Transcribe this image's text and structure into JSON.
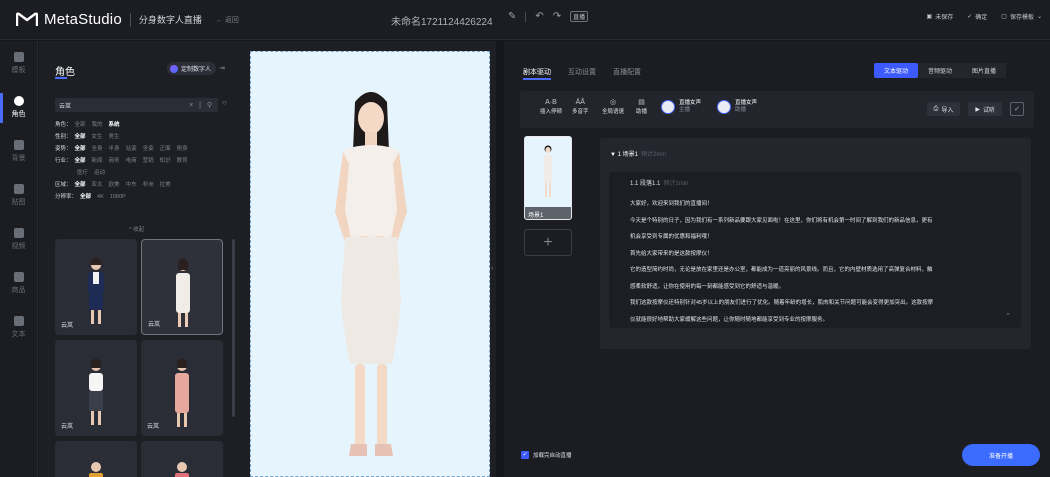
{
  "topbar": {
    "brand": "MetaStudio",
    "product": "分身数字人直播",
    "back_label": "← 返回",
    "project_name": "未命名1721124426224",
    "key_badge": "直播",
    "unsaved": "未保存",
    "confirm": "确定",
    "save_template": "保存模板"
  },
  "rail": {
    "items": [
      {
        "label": "模板",
        "icon": "template-icon"
      },
      {
        "label": "角色",
        "icon": "person-icon"
      },
      {
        "label": "背景",
        "icon": "background-icon"
      },
      {
        "label": "贴图",
        "icon": "sticker-icon"
      },
      {
        "label": "视频",
        "icon": "video-icon"
      },
      {
        "label": "商品",
        "icon": "product-icon"
      },
      {
        "label": "文本",
        "icon": "text-icon"
      }
    ]
  },
  "left": {
    "title": "角色",
    "custom_btn": "定制数字人",
    "search_value": "云岚",
    "search_tools": "× | ⚲",
    "filters": {
      "role": {
        "key": "角色：",
        "opts": [
          "全部",
          "我的",
          "系统"
        ],
        "sel": 2
      },
      "gender": {
        "key": "性别：",
        "opts": [
          "全部",
          "女生",
          "男生"
        ],
        "sel": 0
      },
      "pose": {
        "key": "姿势：",
        "opts": [
          "全部",
          "全身",
          "半身",
          "站姿",
          "坐姿",
          "正面",
          "侧身"
        ],
        "sel": 0
      },
      "industry": {
        "key": "行业：",
        "opts": [
          "全部",
          "新闻",
          "商务",
          "电商",
          "营销",
          "知识",
          "教育"
        ],
        "sel": 0
      },
      "industry2": {
        "opts": [
          "医疗",
          "运动"
        ]
      },
      "region": {
        "key": "区域：",
        "opts": [
          "全部",
          "亚太",
          "欧美",
          "中东",
          "非洲",
          "拉美"
        ],
        "sel": 0
      },
      "resolution": {
        "key": "分辨率：",
        "opts": [
          "全部",
          "4K",
          "1080P"
        ],
        "sel": 0
      }
    },
    "collapse": "^ 收起",
    "cards": [
      "云岚",
      "云岚",
      "云岚",
      "云岚"
    ]
  },
  "right": {
    "tabs": [
      "剧本驱动",
      "互动设置",
      "直播配置"
    ],
    "drive_tabs": [
      "文本驱动",
      "音频驱动",
      "图片直播"
    ],
    "tools": [
      {
        "icon": "A·B",
        "label": "插入停顿"
      },
      {
        "icon": "ÄÅ",
        "label": "多音字"
      },
      {
        "icon": "◎",
        "label": "全局语速"
      },
      {
        "icon": "▤",
        "label": "助播"
      }
    ],
    "voices": [
      {
        "name": "直播女声",
        "role": "主播"
      },
      {
        "name": "直播女声",
        "role": "助播"
      }
    ],
    "import": "导入",
    "audition": "试听",
    "scene_thumb_label": "场景1",
    "add_scene": "+",
    "scene_title": "▼ 1  场景1",
    "scene_meta": "预计2min",
    "para_title": "1.1  段落1.1",
    "para_meta": "预计1min",
    "script_lines": [
      "大家好，欢迎来到我们的直播间！",
      "今天是个特别的日子，因为我们有一系列新品要跟大家见面啦！在这里，你们将有机会第一时间了解到我们的新品信息，更有",
      "机会享受到专属的优惠和福利哦！",
      "首先给大家带来的是这款按摩仪！",
      "它的造型简约时尚，无论是放在家里还是办公室，都能成为一道亮丽的风景线。而且，它的内壁材质选用了高弹复合材料，触",
      "感柔软舒适，让你在使用的每一刻都能感受到它的舒适与温暖。",
      "我们这款按摩仪还特别针对45岁以上的朋友们进行了优化。随着年龄的增长，肌肉和关节问题可能会变得更加突出。这款按摩",
      "仪就能很好地帮助大家缓解这些问题，让你随时随地都能享受到专业的按摩服务。"
    ],
    "auto_start": "加载完自动直播",
    "start_btn": "准备开播"
  },
  "colors": {
    "accent": "#3d5afe",
    "bg": "#15171c",
    "stage": "#e6f5fd"
  }
}
